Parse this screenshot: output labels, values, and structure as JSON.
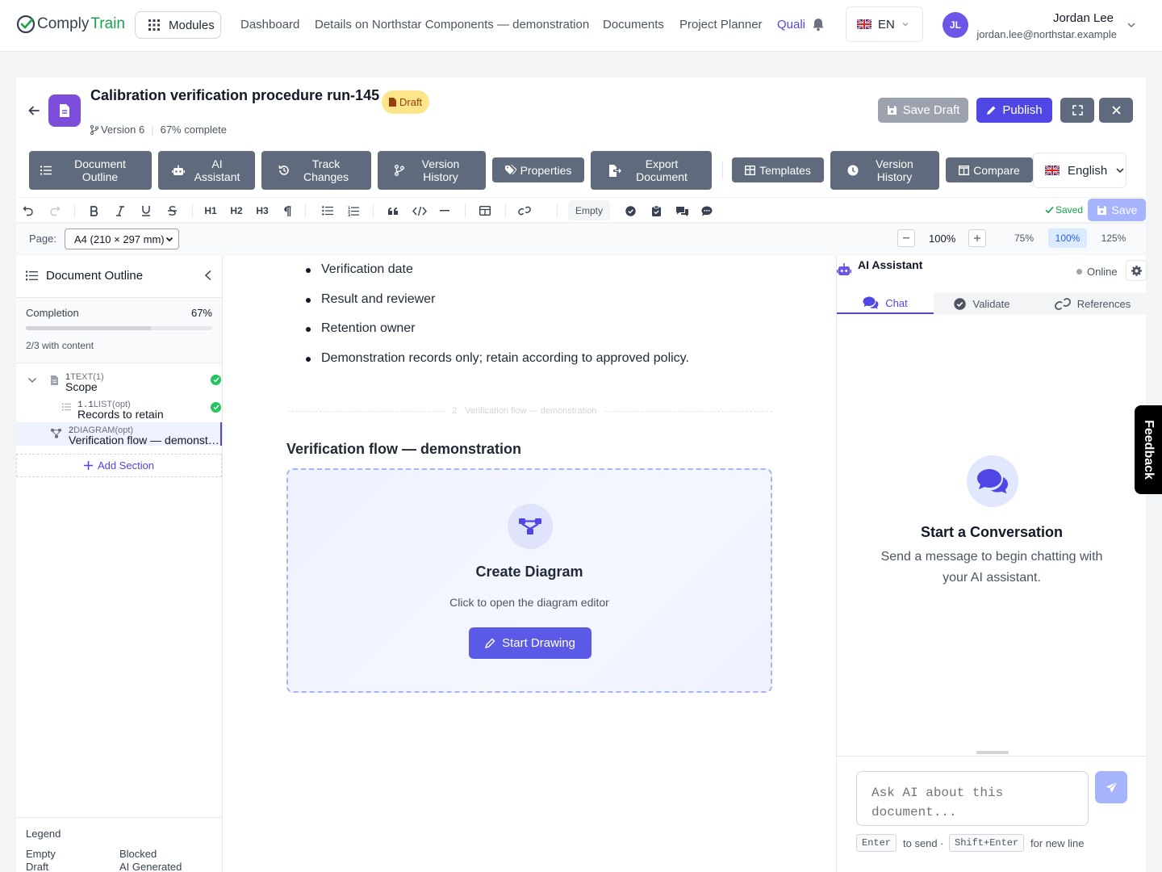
{
  "brand": {
    "part1": "Comply",
    "part2": "Train"
  },
  "topnav": {
    "modules_label": "Modules",
    "links": [
      "Dashboard",
      "Details on Northstar Components — demonstration",
      "Documents",
      "Project Planner",
      "Quali"
    ],
    "active_link": "Quali",
    "language": "EN",
    "user": {
      "initials": "JL",
      "name": "Jordan Lee",
      "email": "jordan.lee@northstar.example"
    }
  },
  "document": {
    "title": "Calibration verification procedure run-145",
    "status": "Draft",
    "version": "Version 6",
    "progress_text": "67% complete",
    "actions": {
      "save_draft": "Save Draft",
      "publish": "Publish"
    }
  },
  "toolbar": {
    "buttons": [
      "Document\nOutline",
      "AI\nAssistant",
      "Track\nChanges",
      "Version\nHistory",
      "Properties",
      "Export\nDocument",
      "Templates",
      "Version\nHistory",
      "Compare"
    ],
    "language": "English"
  },
  "format": {
    "headings": [
      "H1",
      "H2",
      "H3"
    ],
    "status_chip": "Empty",
    "saved": "Saved",
    "save": "Save"
  },
  "pagebar": {
    "label": "Page:",
    "page_size": "A4 (210 × 297 mm)",
    "zoom": "100%",
    "zoom_options": [
      "75%",
      "100%",
      "125%"
    ],
    "zoom_selected": "100%"
  },
  "outline": {
    "title": "Document Outline",
    "completion_label": "Completion",
    "completion_value": "67%",
    "completion_fraction": 0.67,
    "content_count": "2/3 with content",
    "items": [
      {
        "num": "1",
        "type": "TEXT(1)",
        "title": "Scope",
        "complete": true
      },
      {
        "num": "1.1",
        "type": "LIST(opt)",
        "title": "Records to retain",
        "complete": true
      },
      {
        "num": "2",
        "type": "DIAGRAM(opt)",
        "title": "Verification flow — demonstration",
        "complete": false
      }
    ],
    "add_section": "Add Section",
    "legend": {
      "title": "Legend",
      "items": [
        "Empty",
        "Blocked",
        "Draft",
        "AI Generated"
      ]
    }
  },
  "content": {
    "bullets": [
      "Verification date",
      "Result and reviewer",
      "Retention owner",
      "Demonstration records only; retain according to approved policy."
    ],
    "section_number": "2",
    "section_label": "Verification flow — demonstration",
    "section_heading": "Verification flow — demonstration",
    "diagram": {
      "title": "Create Diagram",
      "subtitle": "Click to open the diagram editor",
      "button": "Start Drawing"
    }
  },
  "ai_panel": {
    "title": "AI Assistant",
    "status": "Online",
    "tabs": [
      "Chat",
      "Validate",
      "References"
    ],
    "active_tab": "Chat",
    "empty_title": "Start a Conversation",
    "empty_text": "Send a message to begin chatting with your AI assistant.",
    "input_placeholder": "Ask AI about this document...",
    "hint": {
      "key1": "Enter",
      "text1": "to send ·",
      "key2": "Shift+Enter",
      "text2": "for new line"
    }
  },
  "feedback": "Feedback",
  "colors": {
    "primary": "#4f46e5",
    "slate_button": "#5f6b7d",
    "success": "#22c55e",
    "draft_badge": "#fde68a"
  }
}
